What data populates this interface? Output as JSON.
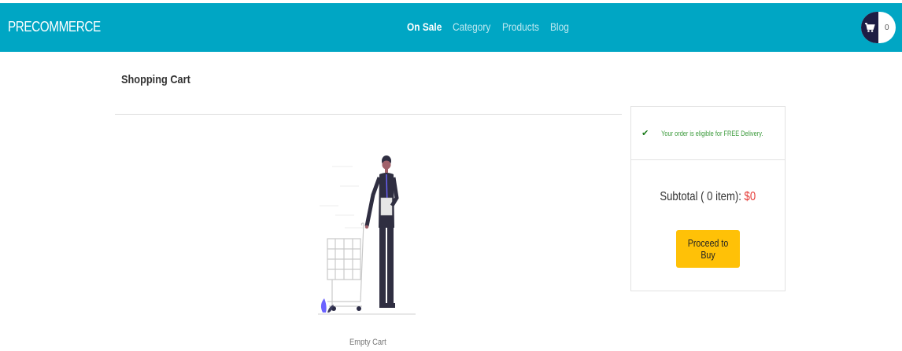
{
  "navbar": {
    "brand": "PRECOMMERCE",
    "links": [
      "On Sale",
      "Category",
      "Products",
      "Blog"
    ],
    "active_link": "On Sale",
    "cart_count": "0",
    "color": "#00a6c4"
  },
  "page": {
    "title": "Shopping Cart",
    "empty_label": "Empty Cart"
  },
  "summary": {
    "delivery_message": "Your order is eligible for FREE Delivery.",
    "subtotal_label": "Subtotal ( 0 item): ",
    "subtotal_amount": "$0",
    "buy_button": "Proceed to Buy",
    "button_color": "#ffc107",
    "amount_color": "#e53935"
  },
  "icons": {
    "cart": "cart-icon",
    "check": "checkmark-icon"
  }
}
